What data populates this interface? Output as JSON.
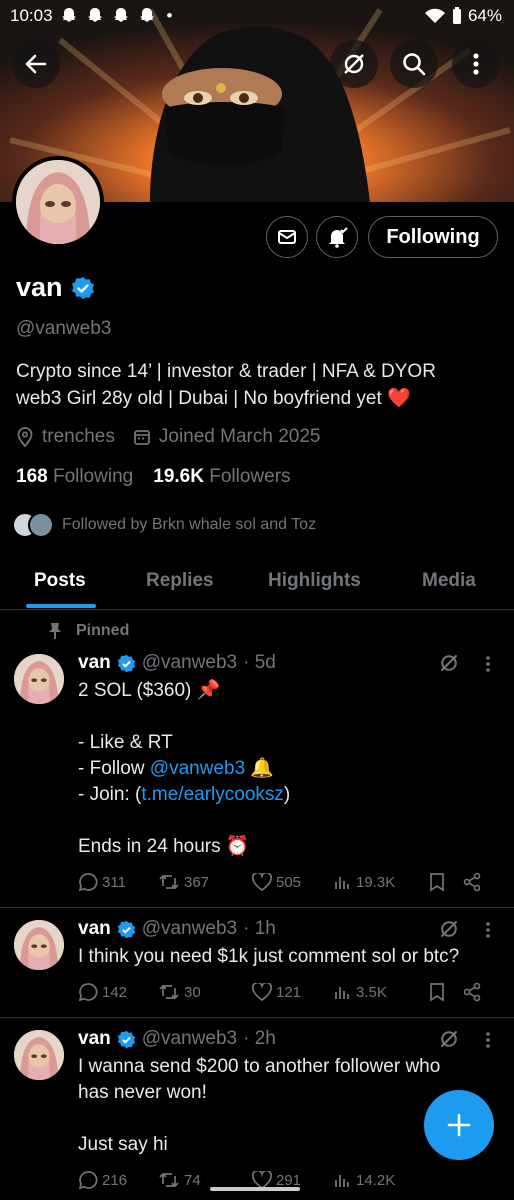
{
  "status_bar": {
    "time": "10:03",
    "dot": "•",
    "battery": "64%"
  },
  "profile": {
    "name": "van",
    "handle": "@vanweb3",
    "bio_line1": "Crypto since 14’ | investor & trader | NFA & DYOR",
    "bio_line2": "web3 Girl 28y old | Dubai | No boyfriend yet ❤️",
    "location": "trenches",
    "joined": "Joined March 2025",
    "following_count": "168",
    "following_label": "Following",
    "followers_count": "19.6K",
    "followers_label": "Followers",
    "followed_by": "Followed by Brkn whale sol and Toz",
    "follow_button": "Following"
  },
  "tabs": [
    "Posts",
    "Replies",
    "Highlights",
    "Media"
  ],
  "pinned_label": "Pinned",
  "posts": [
    {
      "name": "van",
      "handle": "@vanweb3",
      "time": "· 5d",
      "line1": "2 SOL ($360) 📌",
      "line2": "- Like & RT",
      "line3_prefix": "- Follow ",
      "line3_link": "@vanweb3",
      "line3_suffix": " 🔔",
      "line4_prefix": "- Join: (",
      "line4_link": "t.me/earlycooksz",
      "line4_suffix": ")",
      "line5": "Ends in 24 hours ⏰",
      "replies": "311",
      "reposts": "367",
      "likes": "505",
      "views": "19.3K"
    },
    {
      "name": "van",
      "handle": "@vanweb3",
      "time": "· 1h",
      "text": "I think you need $1k just comment sol or btc?",
      "replies": "142",
      "reposts": "30",
      "likes": "121",
      "views": "3.5K"
    },
    {
      "name": "van",
      "handle": "@vanweb3",
      "time": "· 2h",
      "line1": "I wanna send $200 to another follower who",
      "line2": "has never won!",
      "line3": "Just say hi",
      "replies": "216",
      "reposts": "74",
      "likes": "291",
      "views": "14.2K"
    }
  ],
  "colors": {
    "accent": "#1d9bf0",
    "background": "#000000",
    "muted": "#71767b"
  }
}
